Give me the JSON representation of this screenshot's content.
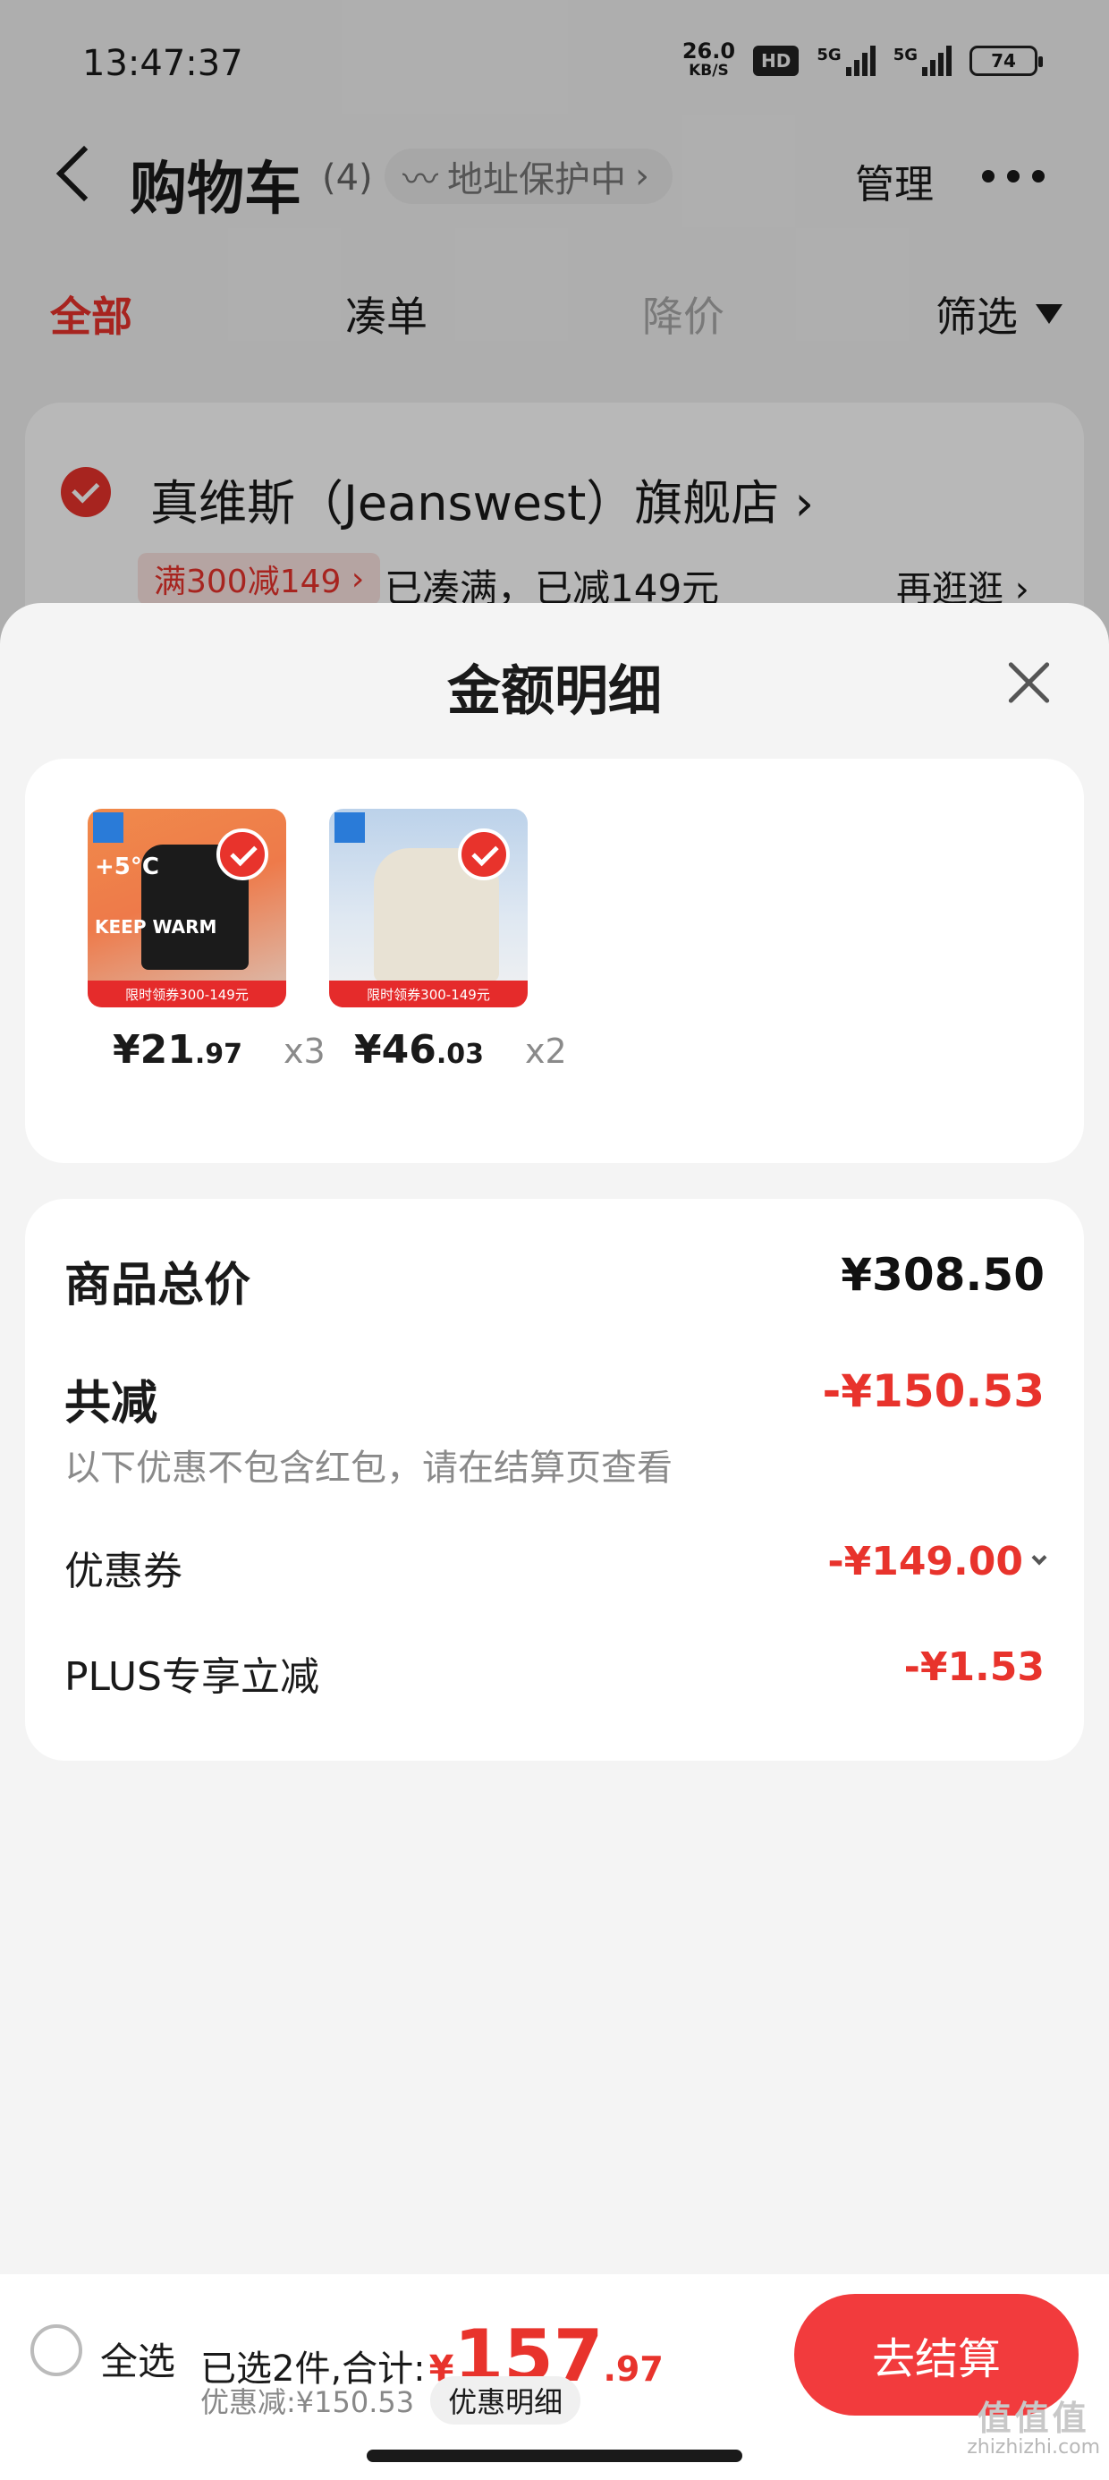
{
  "status_bar": {
    "time": "13:47:37",
    "speed": "26.0",
    "speed_unit": "KB/S",
    "hd": "HD",
    "sig1": "5G",
    "sig2": "5G",
    "battery": "74"
  },
  "navbar": {
    "title": "购物车",
    "count": "(4)",
    "address_protect": "地址保护中",
    "manage": "管理"
  },
  "tabs": {
    "all": "全部",
    "bundle": "凑单",
    "price_drop": "降价",
    "filter": "筛选"
  },
  "store": {
    "name": "真维斯（Jeanswest）旗舰店",
    "promo_tag": "满300减149",
    "promo_text": "已凑满，已减149元",
    "shop_more": "再逛逛"
  },
  "sheet": {
    "title": "金额明细",
    "items": [
      {
        "price_int": "¥21",
        "price_dec": ".97",
        "qty": "x3",
        "thumb_text_1": "+5°C",
        "thumb_text_2": "KEEP WARM",
        "band": "限时领券300-149元"
      },
      {
        "price_int": "¥46",
        "price_dec": ".03",
        "qty": "x2",
        "band": "限时领券300-149元"
      }
    ],
    "summary": {
      "goods_total_label": "商品总价",
      "goods_total": "¥308.50",
      "reduce_label": "共减",
      "reduce_total": "-¥150.53",
      "note": "以下优惠不包含红包，请在结算页查看",
      "coupon_label": "优惠券",
      "coupon_amount": "-¥149.00",
      "plus_label": "PLUS专享立减",
      "plus_amount": "-¥1.53"
    }
  },
  "bottom": {
    "select_all": "全选",
    "selected": "已选2件,合计:",
    "currency": "¥",
    "total_int": "157",
    "total_dec": ".97",
    "discount": "优惠减:¥150.53",
    "detail": "优惠明细",
    "checkout": "去结算"
  },
  "watermark": {
    "mark": "值值值",
    "site": "zhizhizhi.com"
  },
  "colors": {
    "accent": "#e8332c",
    "checkout_bg": "#f23b3d"
  }
}
